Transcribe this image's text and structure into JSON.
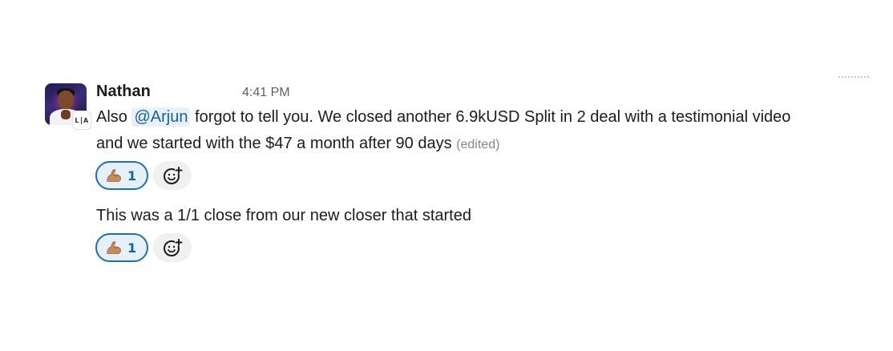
{
  "message": {
    "author": "Nathan",
    "time": "4:41 PM",
    "avatar_badge": {
      "left": "L",
      "right": "A"
    },
    "line1": {
      "prefix": "Also",
      "mention": "@Arjun",
      "suffix": "forgot to tell you. We closed another 6.9kUSD Split in 2 deal with a testimonial video"
    },
    "line2": {
      "text": "and we started with the $47 a month after 90 days",
      "edited": "(edited)"
    },
    "reactions": [
      {
        "emoji": "flexed-biceps",
        "count": "1",
        "active": true
      }
    ]
  },
  "followup": {
    "text": "This was a 1/1 close from our new closer that started",
    "reactions": [
      {
        "emoji": "flexed-biceps",
        "count": "1",
        "active": true
      }
    ]
  },
  "colors": {
    "mention_text": "#1264a3",
    "mention_bg": "#e8f1fa",
    "reaction_border": "#1d6fb8",
    "reaction_bg": "#e6f0f9"
  }
}
